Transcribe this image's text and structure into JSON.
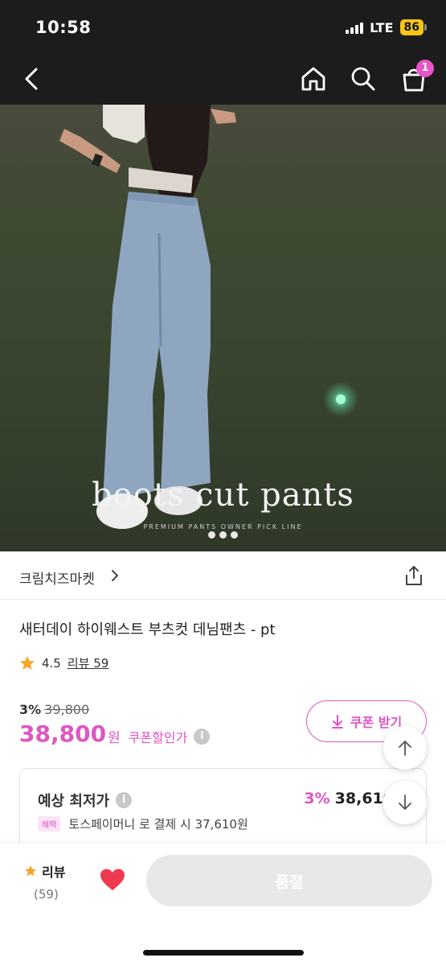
{
  "status_bar": {
    "time": "10:58",
    "network": "LTE",
    "battery": "86"
  },
  "nav": {
    "cart_count": "1"
  },
  "hero": {
    "caption": "boots cut pants",
    "subcaption": "PREMIUM PANTS OWNER PICK LINE",
    "slide_count": 3
  },
  "store": {
    "name": "크림치즈마켓"
  },
  "product": {
    "title": "새터데이 하이웨스트 부츠컷 데님팬츠 - pt",
    "rating": "4.5",
    "review_link": "리뷰 59"
  },
  "price": {
    "discount_rate": "3%",
    "original": "39,800",
    "current": "38,800",
    "currency": "원",
    "coupon_discount_label": "쿠폰할인가",
    "info_symbol": "i"
  },
  "coupon_button": {
    "label": "쿠폰 받기"
  },
  "lowest": {
    "label": "예상 최저가",
    "rate": "3%",
    "price": "38,610",
    "benefit_tag": "혜택",
    "benefit_text": "토스페이머니 로 결제 시 37,610원"
  },
  "bottom": {
    "review_label": "리뷰",
    "review_count": "(59)",
    "soldout_label": "품절"
  },
  "colors": {
    "accent": "#e054c6",
    "badge": "#e855c8",
    "heart": "#ef3a4f",
    "star": "#f5a623"
  },
  "icons": [
    "back-icon",
    "home-icon",
    "search-icon",
    "cart-icon",
    "chevron-right-icon",
    "share-icon",
    "star-icon",
    "info-icon",
    "download-icon",
    "arrow-up-icon",
    "arrow-down-icon",
    "heart-icon"
  ]
}
